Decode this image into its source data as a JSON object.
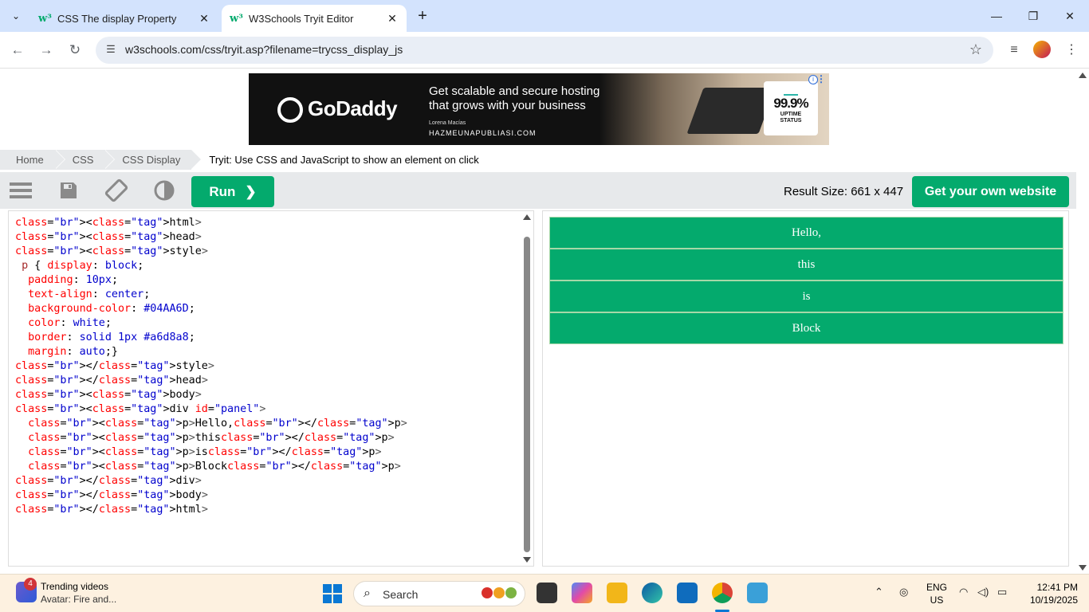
{
  "browser": {
    "tabs": [
      {
        "title": "CSS The display Property",
        "active": false
      },
      {
        "title": "W3Schools Tryit Editor",
        "active": true
      }
    ],
    "new_tab": "+",
    "url": "w3schools.com/css/tryit.asp?filename=trycss_display_js"
  },
  "ad": {
    "brand": "GoDaddy",
    "headline": "Get scalable and secure hosting that grows with your business",
    "credit": "Lorena Macías",
    "site": "HAZMEUNAPUBLIASI.COM",
    "uptime_value": "99.9%",
    "uptime_label_1": "UPTIME",
    "uptime_label_2": "STATUS"
  },
  "breadcrumb": {
    "items": [
      "Home",
      "CSS",
      "CSS Display"
    ],
    "current": "Tryit: Use CSS and JavaScript to show an element on click"
  },
  "editor": {
    "run_label": "Run",
    "result_size": "Result Size: 661 x 447",
    "own_website": "Get your own website"
  },
  "code_lines": [
    "<html>",
    "<head>",
    "<style>",
    " p { display: block;",
    "  padding: 10px;",
    "  text-align: center;",
    "  background-color: #04AA6D;",
    "  color: white;",
    "  border: solid 1px #a6d8a8;",
    "  margin: auto;}",
    "</style>",
    "</head>",
    "<body>",
    "<div id=\"panel\">",
    "  <p>Hello,</p>",
    "  <p>this</p>",
    "  <p>is</p>",
    "  <p>Block</p>",
    "</div>",
    "</body>",
    "</html>"
  ],
  "result": {
    "paragraphs": [
      "Hello,",
      "this",
      "is",
      "Block"
    ]
  },
  "colors": {
    "accent": "#04AA6D",
    "border": "#a6d8a8",
    "tabstrip": "#d3e3fd"
  },
  "taskbar": {
    "news_title": "Trending videos",
    "news_sub": "Avatar: Fire and...",
    "news_badge": "4",
    "search_placeholder": "Search",
    "lang_1": "ENG",
    "lang_2": "US",
    "time": "12:41 PM",
    "date": "10/19/2025"
  }
}
